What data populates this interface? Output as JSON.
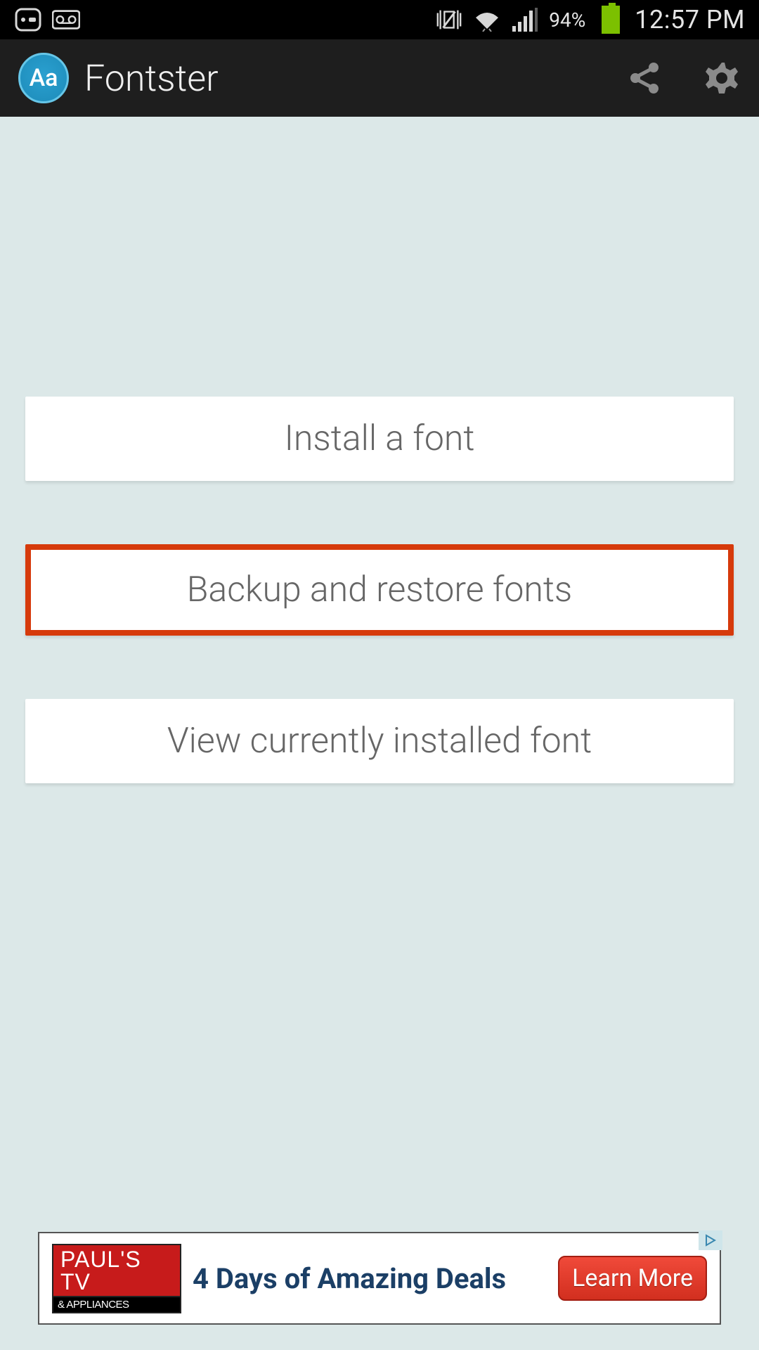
{
  "status_bar": {
    "battery_pct": "94%",
    "time": "12:57 PM"
  },
  "app_bar": {
    "title": "Fontster",
    "icon_text": "Aa"
  },
  "main": {
    "buttons": [
      {
        "label": "Install a font",
        "highlight": false
      },
      {
        "label": "Backup and restore fonts",
        "highlight": true
      },
      {
        "label": "View currently installed font",
        "highlight": false
      }
    ]
  },
  "ad": {
    "logo_top": "PAUL'S TV",
    "logo_bottom": "& APPLIANCES",
    "text": "4 Days of Amazing Deals",
    "button": "Learn More"
  }
}
